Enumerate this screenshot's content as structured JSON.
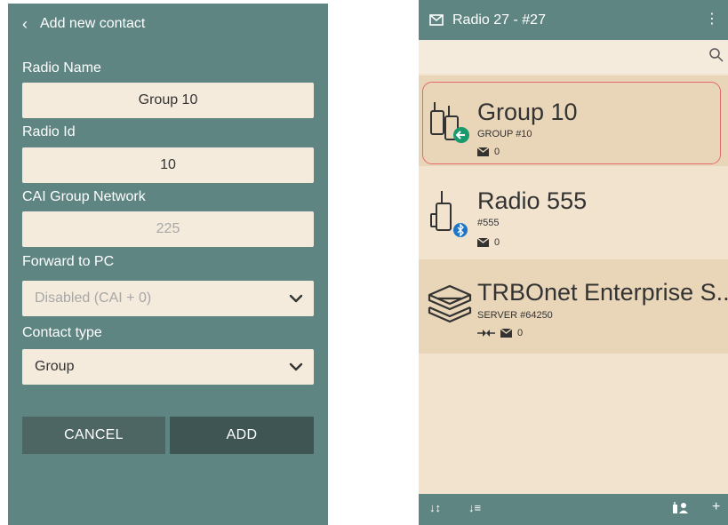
{
  "add_contact": {
    "back_icon": "chevron-left-icon",
    "title": "Add new contact",
    "radio_name_label": "Radio Name",
    "radio_name_value": "Group 10",
    "radio_id_label": "Radio Id",
    "radio_id_value": "10",
    "cai_label": "CAI Group Network",
    "cai_value": "225",
    "forward_label": "Forward to PC",
    "forward_value": "Disabled (CAI + 0)",
    "contact_type_label": "Contact type",
    "contact_type_value": "Group",
    "cancel_label": "CANCEL",
    "add_label": "ADD"
  },
  "radio_list": {
    "title": "Radio 27 - #27",
    "menu_icon": "more-vert-icon",
    "search_icon": "search-icon",
    "items": [
      {
        "title": "Group 10",
        "subtitle": "GROUP #10",
        "messages": "0",
        "badge": "green-arrow",
        "selected": true
      },
      {
        "title": "Radio 555",
        "subtitle": "#555",
        "messages": "0",
        "badge": "bluetooth",
        "selected": false
      },
      {
        "title": "TRBOnet Enterprise S...",
        "subtitle": "SERVER #64250",
        "messages": "0",
        "badge": "connector",
        "selected": false
      }
    ],
    "bottom_icons": [
      "sort-az-icon",
      "sort-list-icon",
      "add-contact-icon",
      "plus-icon"
    ],
    "colors": {
      "accent": "#5f8583",
      "background": "#f1e3ce",
      "selection": "#e26a6a",
      "green_badge": "#1a9b6e",
      "blue_badge": "#1e74c6"
    }
  }
}
